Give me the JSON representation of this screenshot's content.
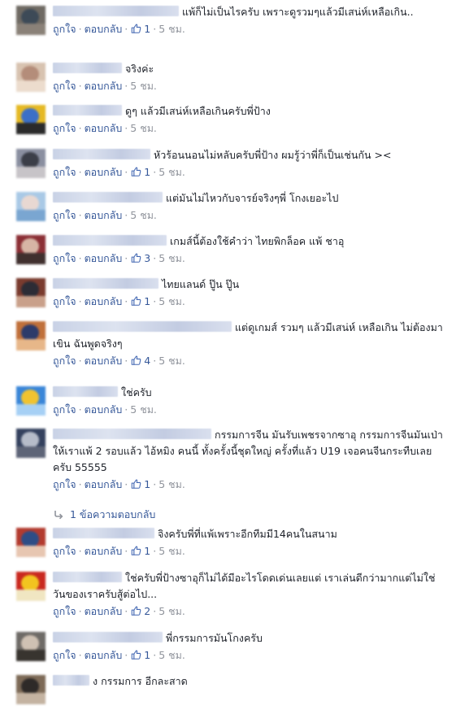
{
  "actions": {
    "like": "ถูกใจ",
    "reply": "ตอบกลับ",
    "dot": "·"
  },
  "comments": [
    {
      "text": "แพ้ก็ไม่เป็นไรครับ เพราะดูรวมๆแล้วมีเสน่ห์เหลือเกิน..",
      "likes": "1",
      "time": "5 ชม."
    },
    {
      "text": "จริงค่ะ",
      "likes": "",
      "time": "5 ชม."
    },
    {
      "text": "ดูๆ แล้วมีเสน่ห์เหลือเกินครับพี่ป้าง",
      "likes": "",
      "time": "5 ชม."
    },
    {
      "text": "หัวร้อนนอนไม่หลับครับพี่ป้าง ผมรู้ว่าพี่ก็เป็นเช่นกัน ><",
      "likes": "1",
      "time": "5 ชม."
    },
    {
      "text": "แต่มันไม่ไหวกับจารย์จริงๆพี่ โกงเยอะไป",
      "likes": "",
      "time": "5 ชม."
    },
    {
      "text": "เกมส์นี้ต้องใช้คำว่า ไทยพิกล็อค แพ้ ชาอุ",
      "likes": "3",
      "time": "5 ชม."
    },
    {
      "text": "ไทยแลนด์ ปู๊น ปู๊น",
      "likes": "1",
      "time": "5 ชม."
    },
    {
      "text": "แต่ดูเกมส์ รวมๆ แล้วมีเสน่ห์ เหลือเกิน ไม่ต้องมาเขิน ฉันพูดจริงๆ",
      "likes": "4",
      "time": "5 ชม."
    },
    {
      "text": "ใช่ครับ",
      "likes": "",
      "time": "5 ชม."
    },
    {
      "text": "กรรมการจีน มันรับเพชรจากซาอุ กรรมการจีนมันเป่า ให้เราแพ้ 2 รอบแล้ว ไอ้หมิง คนนี้ ทั้งครั้งนี้ชุดใหญ่ ครั้งที่แล้ว U19 เจอคนจีนกระทืบเลยครับ 55555",
      "likes": "1",
      "time": "5 ชม."
    },
    {
      "text": "จิงครับพี่ที่แพ้เพราะอีกทีมมี14คนในสนาม",
      "likes": "1",
      "time": "5 ชม."
    },
    {
      "text": "ใช่ครับพี่ป้างซาอุก็ไม่ได้มีอะไรโดดเด่นเลยแต่ เราเล่นดีกว่ามากแต่ไม่ใช่วันของเราครับสู้ต่อไป...",
      "likes": "2",
      "time": "5 ชม."
    },
    {
      "text": "พี่กรรมการมันโกงครับ",
      "likes": "1",
      "time": "5 ชม."
    },
    {
      "text": "ง กรรมการ อีกละสาด",
      "likes": "",
      "time": ""
    }
  ],
  "replies_link": "1 ข้อความตอบกลับ",
  "colors": {
    "link": "#365899",
    "meta": "#90949c",
    "text": "#1d2129"
  }
}
